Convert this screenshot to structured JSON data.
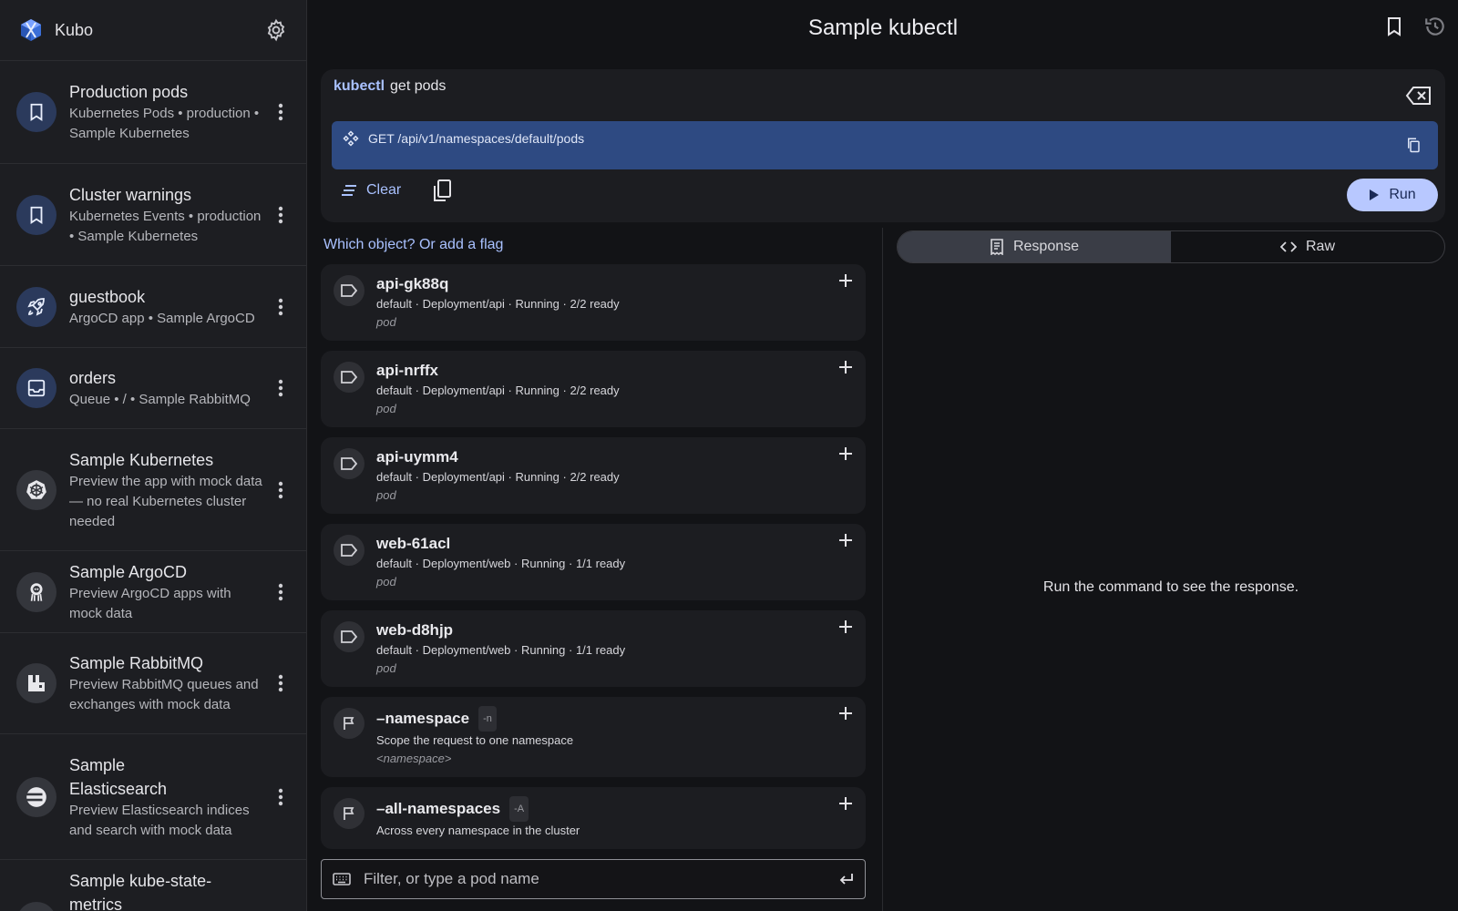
{
  "app": {
    "name": "Kubo"
  },
  "sidebar": {
    "items": [
      {
        "name": "Production pods",
        "sub": "Kubernetes Pods • production • Sample Kubernetes",
        "icon": "bookmark-icon"
      },
      {
        "name": "Cluster warnings",
        "sub": "Kubernetes Events • production • Sample Kubernetes",
        "icon": "bookmark-icon"
      },
      {
        "name": "guestbook",
        "sub": "ArgoCD app • Sample ArgoCD",
        "icon": "rocket-icon"
      },
      {
        "name": "orders",
        "sub": "Queue • / • Sample RabbitMQ",
        "icon": "inbox-icon"
      },
      {
        "name": "Sample Kubernetes",
        "sub": "Preview the app with mock data — no real Kubernetes cluster needed",
        "icon": "kubernetes-icon"
      },
      {
        "name": "Sample ArgoCD",
        "sub": "Preview ArgoCD apps with mock data",
        "icon": "argocd-icon"
      },
      {
        "name": "Sample RabbitMQ",
        "sub": "Preview RabbitMQ queues and exchanges with mock data",
        "icon": "rabbitmq-icon"
      },
      {
        "name": "Sample Elasticsearch",
        "sub": "Preview Elasticsearch indices and search with mock data",
        "icon": "elasticsearch-icon"
      },
      {
        "name": "Sample kube-state-metrics",
        "sub": "",
        "icon": "metrics-icon"
      }
    ]
  },
  "header": {
    "title": "Sample kubectl"
  },
  "command": {
    "keyword": "kubectl",
    "text": "get pods",
    "api": "GET /api/v1/namespaces/default/pods",
    "clear_label": "Clear",
    "run_label": "Run"
  },
  "hint": "Which object? Or add a flag",
  "suggestions": [
    {
      "title": "api-gk88q",
      "alias": "",
      "desc": "default · Deployment/api · Running · 2/2 ready",
      "kind": "pod",
      "icon": "label-icon"
    },
    {
      "title": "api-nrffx",
      "alias": "",
      "desc": "default · Deployment/api · Running · 2/2 ready",
      "kind": "pod",
      "icon": "label-icon"
    },
    {
      "title": "api-uymm4",
      "alias": "",
      "desc": "default · Deployment/api · Running · 2/2 ready",
      "kind": "pod",
      "icon": "label-icon"
    },
    {
      "title": "web-61acl",
      "alias": "",
      "desc": "default · Deployment/web · Running · 1/1 ready",
      "kind": "pod",
      "icon": "label-icon"
    },
    {
      "title": "web-d8hjp",
      "alias": "",
      "desc": "default · Deployment/web · Running · 1/1 ready",
      "kind": "pod",
      "icon": "label-icon"
    },
    {
      "title": "–namespace",
      "alias": "-n",
      "desc": "Scope the request to one namespace",
      "kind": "<namespace>",
      "icon": "flag-icon"
    },
    {
      "title": "–all-namespaces",
      "alias": "-A",
      "desc": "Across every namespace in the cluster",
      "kind": "",
      "icon": "flag-icon"
    }
  ],
  "filter": {
    "placeholder": "Filter, or type a pod name"
  },
  "response": {
    "tabs": [
      {
        "label": "Response",
        "active": true
      },
      {
        "label": "Raw",
        "active": false
      }
    ],
    "empty_text": "Run the command to see the response."
  },
  "colors": {
    "accent": "#a9c1ff",
    "api_bar": "#2e4a82",
    "run_button": "#b8c8ff"
  }
}
